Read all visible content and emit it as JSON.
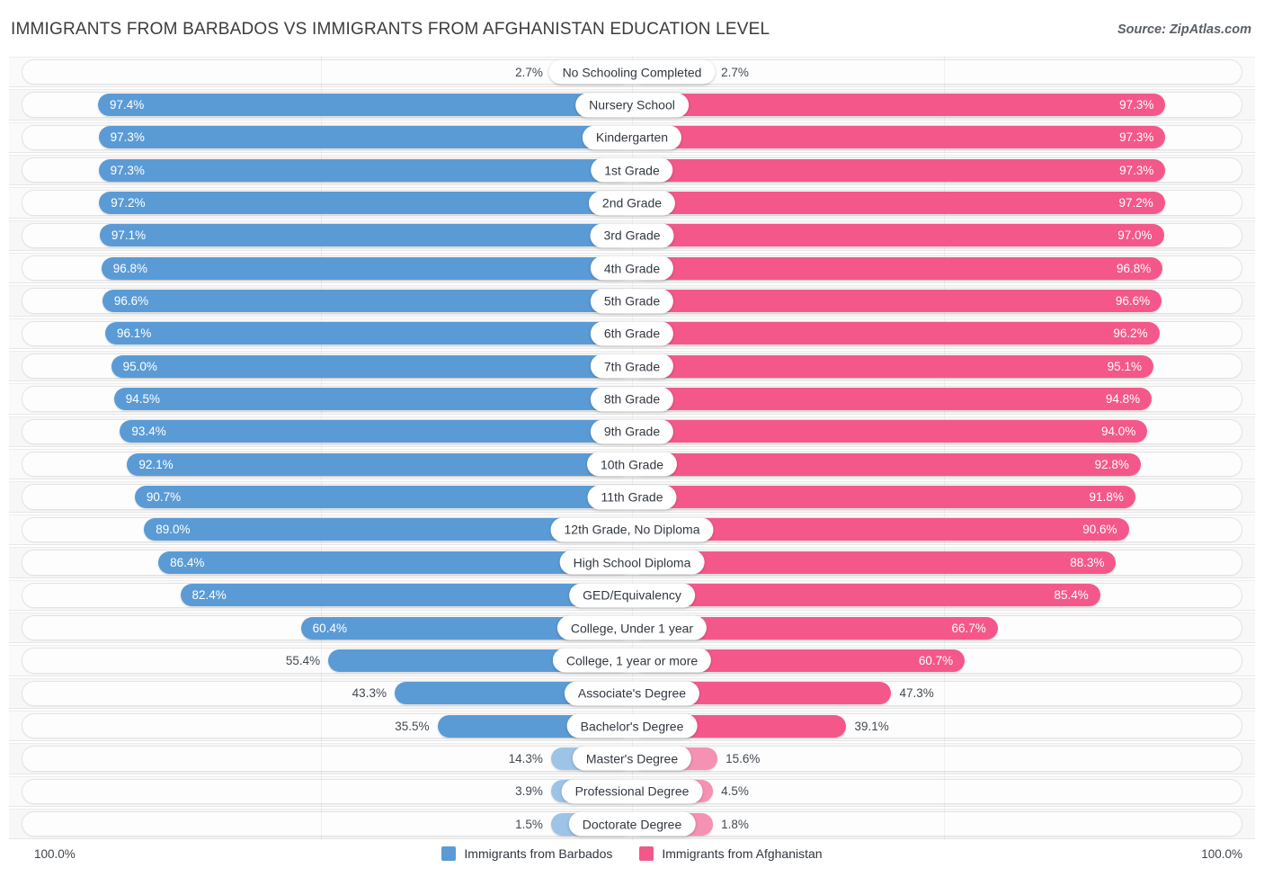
{
  "header": {
    "title": "IMMIGRANTS FROM BARBADOS VS IMMIGRANTS FROM AFGHANISTAN EDUCATION LEVEL",
    "source": "Source: ZipAtlas.com"
  },
  "legend": {
    "left_label": "Immigrants from Barbados",
    "right_label": "Immigrants from Afghanistan",
    "left_color": "#5b9bd5",
    "right_color": "#f4588b"
  },
  "axis": {
    "left_max": "100.0%",
    "right_max": "100.0%"
  },
  "chart_data": {
    "type": "bar",
    "title": "IMMIGRANTS FROM BARBADOS VS IMMIGRANTS FROM AFGHANISTAN EDUCATION LEVEL",
    "subtitle": "",
    "xlabel": "",
    "ylabel": "",
    "orientation": "horizontal-diverging",
    "xlim": [
      0,
      100
    ],
    "grid": false,
    "legend_position": "bottom-center",
    "categories": [
      "No Schooling Completed",
      "Nursery School",
      "Kindergarten",
      "1st Grade",
      "2nd Grade",
      "3rd Grade",
      "4th Grade",
      "5th Grade",
      "6th Grade",
      "7th Grade",
      "8th Grade",
      "9th Grade",
      "10th Grade",
      "11th Grade",
      "12th Grade, No Diploma",
      "High School Diploma",
      "GED/Equivalency",
      "College, Under 1 year",
      "College, 1 year or more",
      "Associate's Degree",
      "Bachelor's Degree",
      "Master's Degree",
      "Professional Degree",
      "Doctorate Degree"
    ],
    "series": [
      {
        "name": "Immigrants from Barbados",
        "color": "#5b9bd5",
        "values": [
          2.7,
          97.4,
          97.3,
          97.3,
          97.2,
          97.1,
          96.8,
          96.6,
          96.1,
          95.0,
          94.5,
          93.4,
          92.1,
          90.7,
          89.0,
          86.4,
          82.4,
          60.4,
          55.4,
          43.3,
          35.5,
          14.3,
          3.9,
          1.5
        ],
        "labels": [
          "2.7%",
          "97.4%",
          "97.3%",
          "97.3%",
          "97.2%",
          "97.1%",
          "96.8%",
          "96.6%",
          "96.1%",
          "95.0%",
          "94.5%",
          "93.4%",
          "92.1%",
          "90.7%",
          "89.0%",
          "86.4%",
          "82.4%",
          "60.4%",
          "55.4%",
          "43.3%",
          "35.5%",
          "14.3%",
          "3.9%",
          "1.5%"
        ]
      },
      {
        "name": "Immigrants from Afghanistan",
        "color": "#f4588b",
        "values": [
          2.7,
          97.3,
          97.3,
          97.3,
          97.2,
          97.0,
          96.8,
          96.6,
          96.2,
          95.1,
          94.8,
          94.0,
          92.8,
          91.8,
          90.6,
          88.3,
          85.4,
          66.7,
          60.7,
          47.3,
          39.1,
          15.6,
          4.5,
          1.8
        ],
        "labels": [
          "2.7%",
          "97.3%",
          "97.3%",
          "97.3%",
          "97.2%",
          "97.0%",
          "96.8%",
          "96.6%",
          "96.2%",
          "95.1%",
          "94.8%",
          "94.0%",
          "92.8%",
          "91.8%",
          "90.6%",
          "88.3%",
          "85.4%",
          "66.7%",
          "60.7%",
          "47.3%",
          "39.1%",
          "15.6%",
          "4.5%",
          "1.8%"
        ]
      }
    ]
  }
}
